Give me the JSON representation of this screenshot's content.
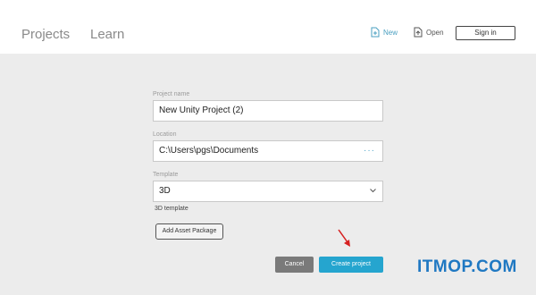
{
  "nav": {
    "projects": "Projects",
    "learn": "Learn"
  },
  "header": {
    "new_label": "New",
    "open_label": "Open",
    "signin_label": "Sign in"
  },
  "form": {
    "project_name_label": "Project name",
    "project_name_value": "New Unity Project (2)",
    "location_label": "Location",
    "location_value": "C:\\Users\\pgs\\Documents",
    "location_more": "···",
    "template_label": "Template",
    "template_value": "3D",
    "template_desc": "3D template",
    "add_asset_label": "Add Asset Package",
    "cancel_label": "Cancel",
    "create_label": "Create project"
  },
  "icons": {
    "new": "new-file-icon",
    "open": "open-file-icon",
    "dropdown": "chevron-down-icon",
    "annotation": "red-arrow-icon"
  },
  "colors": {
    "accent": "#25a5cf",
    "cancel": "#7a7a7a",
    "annotation": "#d62020",
    "watermark": "#1f78c2"
  },
  "watermark": "ITMOP.COM"
}
